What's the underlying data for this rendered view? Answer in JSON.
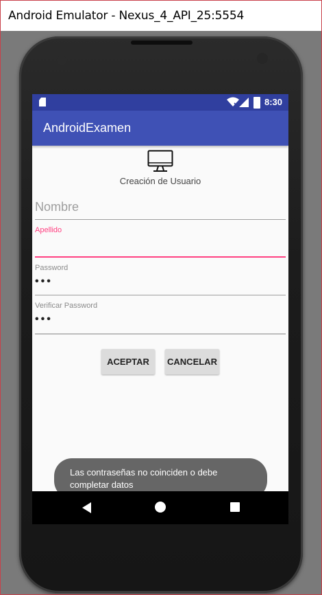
{
  "window": {
    "title": "Android Emulator - Nexus_4_API_25:5554"
  },
  "status_bar": {
    "time": "8:30"
  },
  "app_bar": {
    "title": "AndroidExamen"
  },
  "form": {
    "heading": "Creación de Usuario",
    "nombre": {
      "placeholder": "Nombre",
      "value": ""
    },
    "apellido": {
      "label": "Apellido",
      "value": ""
    },
    "password": {
      "label": "Password",
      "value": "•••"
    },
    "verificar": {
      "label": "Verificar Password",
      "value": "•••"
    },
    "accept_label": "ACEPTAR",
    "cancel_label": "CANCELAR"
  },
  "toast": {
    "message": "Las contraseñas no coinciden o debe completar datos"
  },
  "colors": {
    "status_bar": "#303f9f",
    "app_bar": "#3f51b5",
    "accent": "#ff4081"
  },
  "icons": [
    "sd-card-icon",
    "wifi-icon",
    "signal-icon",
    "battery-icon",
    "monitor-icon",
    "back-icon",
    "home-icon",
    "recents-icon"
  ]
}
